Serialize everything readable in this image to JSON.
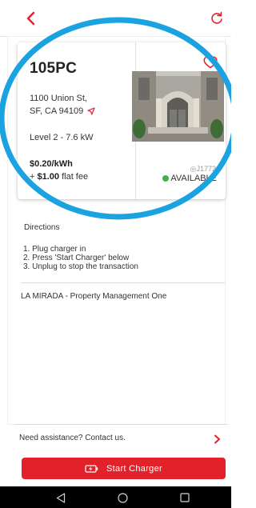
{
  "colors": {
    "accent": "#e3212b",
    "annotation_ring": "#1aa3e0",
    "available_dot": "#39b54a"
  },
  "header": {
    "back_icon": "chevron-left-icon",
    "refresh_icon": "refresh-icon"
  },
  "station": {
    "id": "105PC",
    "address_line1": "1100 Union St,",
    "address_line2": "SF, CA 94109",
    "level": "Level 2 - 7.6 kW",
    "price": "$0.20/kWh",
    "fee_prefix": "+ ",
    "fee_amount": "$1.00",
    "fee_suffix": " flat fee",
    "connector": "J1772",
    "status": "AVAILABLE",
    "favorite_icon": "heart-icon"
  },
  "directions": {
    "title": "Directions",
    "steps": [
      "1. Plug charger in",
      "2. Press 'Start Charger' below",
      "3. Unplug to stop the transaction"
    ]
  },
  "property": "LA MIRADA - Property Management One",
  "assistance": {
    "label": "Need assistance? Contact us."
  },
  "start_button": {
    "label": "Start Charger"
  },
  "nav": {
    "back": "nav-back-icon",
    "home": "nav-home-icon",
    "recents": "nav-recents-icon"
  }
}
